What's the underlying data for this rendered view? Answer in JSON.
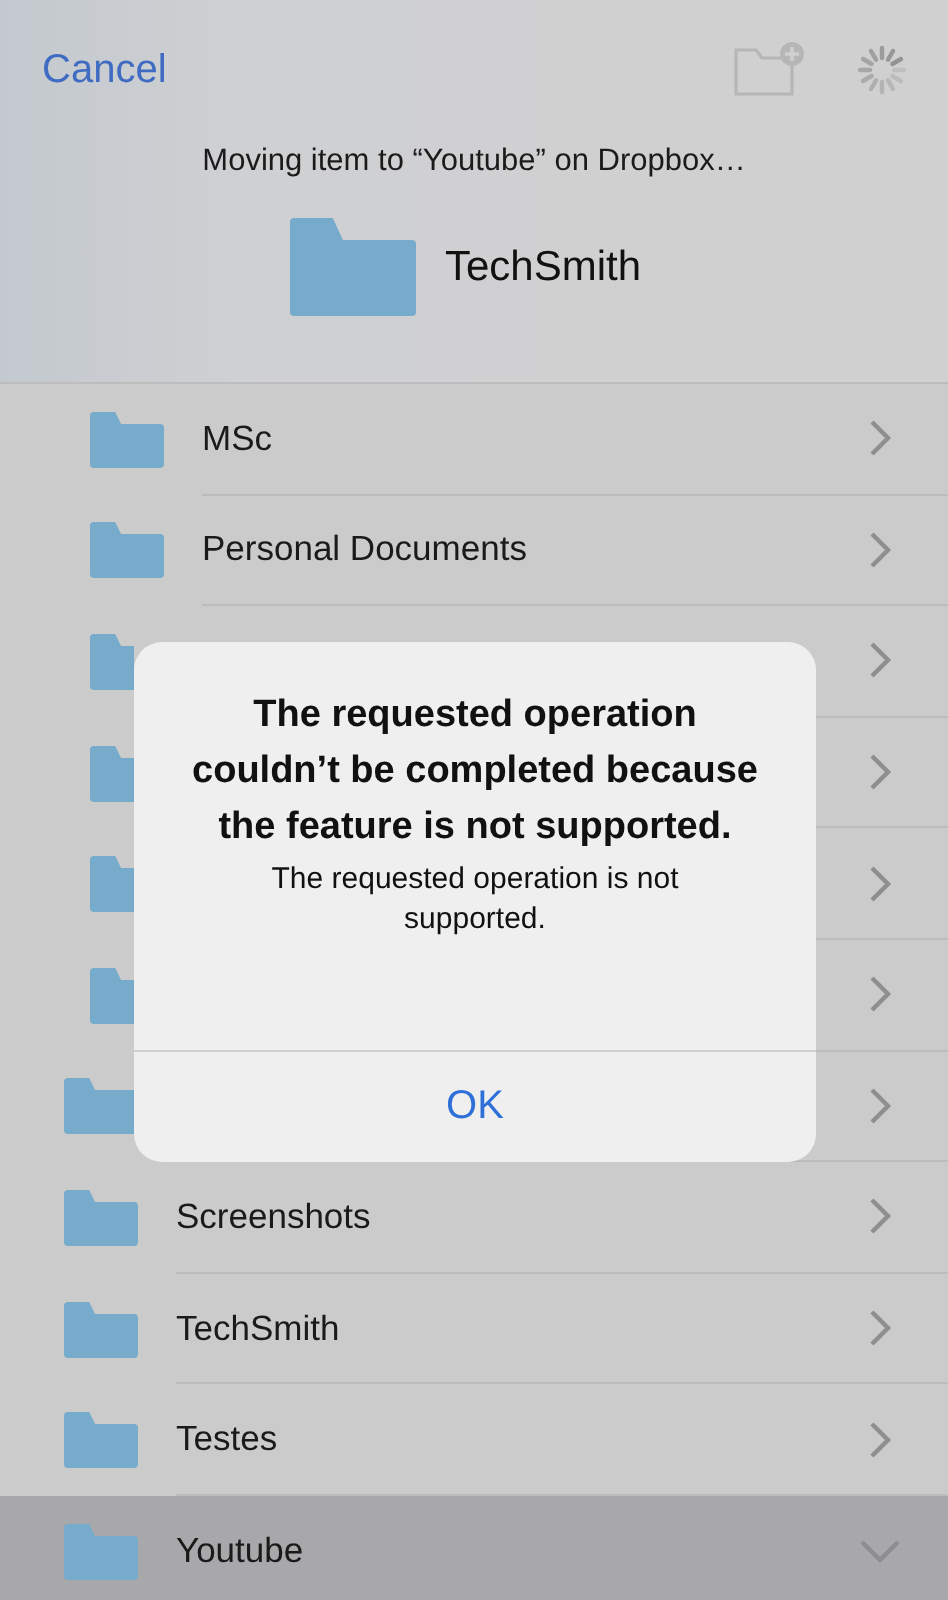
{
  "nav": {
    "cancel": "Cancel",
    "new_folder_disabled": true,
    "loading": true
  },
  "status": "Moving item to “Youtube” on Dropbox…",
  "current_folder": "TechSmith",
  "folders": [
    {
      "children": [
        {
          "name": "MSc",
          "expanded": false,
          "selected": false
        },
        {
          "name": "Personal Documents",
          "expanded": false,
          "selected": false
        },
        {
          "expanded": false,
          "selected": false
        },
        {
          "expanded": false,
          "selected": false
        },
        {
          "expanded": false,
          "selected": false
        },
        {
          "expanded": false,
          "selected": false
        }
      ]
    },
    {
      "expanded": false,
      "selected": false
    },
    {
      "name": "Screenshots",
      "expanded": false,
      "selected": false
    },
    {
      "name": "TechSmith",
      "expanded": false,
      "selected": false
    },
    {
      "name": "Testes",
      "expanded": false,
      "selected": false
    },
    {
      "name": "Youtube",
      "expanded": true,
      "selected": true
    }
  ],
  "alert": {
    "title": "The requested operation couldn’t be completed because the feature is not supported.",
    "message": "The requested operation is not supported.",
    "buttons": [
      "OK"
    ]
  }
}
